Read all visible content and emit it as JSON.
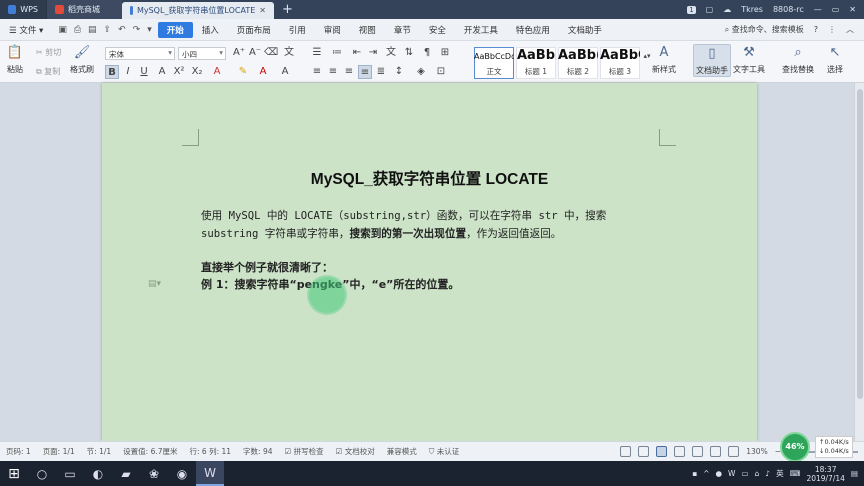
{
  "tabs": [
    {
      "label": "WPS"
    },
    {
      "label": "稻壳商城"
    },
    {
      "label": "MySQL_获取字符串位置LOCATE"
    }
  ],
  "titlebar": {
    "badge": "1",
    "user": "Tkres",
    "device": "8808-rc"
  },
  "menubar": {
    "file": "文件",
    "items": [
      "开始",
      "插入",
      "页面布局",
      "引用",
      "审阅",
      "视图",
      "章节",
      "安全",
      "开发工具",
      "特色应用",
      "文档助手"
    ],
    "search_hint": "查找命令、搜索模板"
  },
  "ribbon": {
    "paste": "粘贴",
    "cut": "剪切",
    "copy": "复制",
    "format_painter": "格式刷",
    "font_name": "宋体",
    "font_size": "小四",
    "styles": [
      {
        "preview": "AaBbCcDd",
        "label": "正文"
      },
      {
        "preview": "AaBb",
        "label": "标题 1"
      },
      {
        "preview": "AaBb(",
        "label": "标题 2"
      },
      {
        "preview": "AaBbC",
        "label": "标题 3"
      }
    ],
    "new_style": "新样式",
    "doc_assistant": "文档助手",
    "text_tool": "文字工具",
    "find_replace": "查找替换",
    "select": "选择"
  },
  "document": {
    "title": "MySQL_获取字符串位置 LOCATE",
    "p1_a": "使用 MySQL 中的 LOCATE（substring,str）函数，可以在字符串 str 中，搜索",
    "p1_b": "substring 字符串或字符串，",
    "p1_bold": "搜索到的第一次出现位置",
    "p1_c": "，作为返回值返回。",
    "p2": "直接举个例子就很清晰了：",
    "p3": "例 1：搜索字符串“pengke”中，“e”所在的位置。"
  },
  "statusbar": {
    "page": "页码: 1",
    "pages": "页面: 1/1",
    "section": "节: 1/1",
    "settings": "设置值: 6.7厘米",
    "rowcol": "行: 6  列: 11",
    "words": "字数: 94",
    "spellcheck": "拼写检查",
    "doc_check": "文档校对",
    "compat": "兼容模式",
    "cert": "未认证",
    "zoom": "130%"
  },
  "net": {
    "percent": "46%",
    "up": "0.04K/s",
    "down": "0.04K/s"
  },
  "taskbar": {
    "ime": "英",
    "time": "18:37",
    "date": "2019/7/14"
  }
}
